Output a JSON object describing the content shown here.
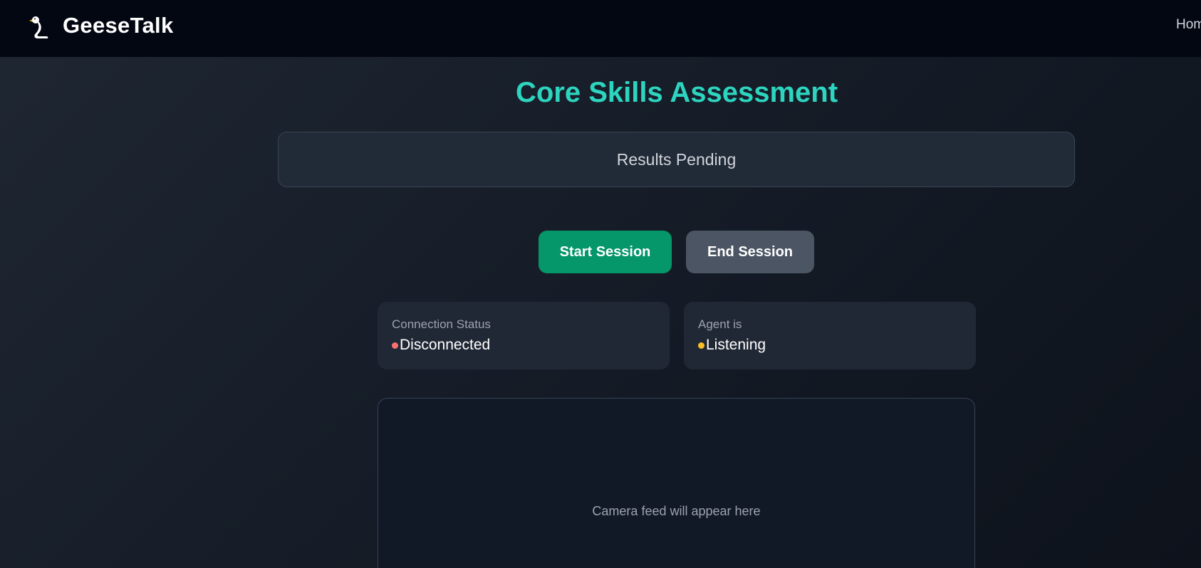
{
  "app": {
    "brand_name": "GeeseTalk",
    "logo_icon": "goose-icon"
  },
  "nav": {
    "home_label": "Hom"
  },
  "page": {
    "title": "Core Skills Assessment"
  },
  "results": {
    "text": "Results Pending"
  },
  "actions": {
    "start_label": "Start Session",
    "end_label": "End Session"
  },
  "status": {
    "connection": {
      "label": "Connection Status",
      "value": "Disconnected",
      "color": "#f87171"
    },
    "agent": {
      "label": "Agent is",
      "value": "Listening",
      "color": "#fbbf24"
    }
  },
  "camera": {
    "placeholder": "Camera feed will appear here"
  },
  "colors": {
    "accent": "#2dd4bf",
    "start_button": "#059669",
    "end_button": "#4b5563",
    "navbar": "#030712"
  }
}
